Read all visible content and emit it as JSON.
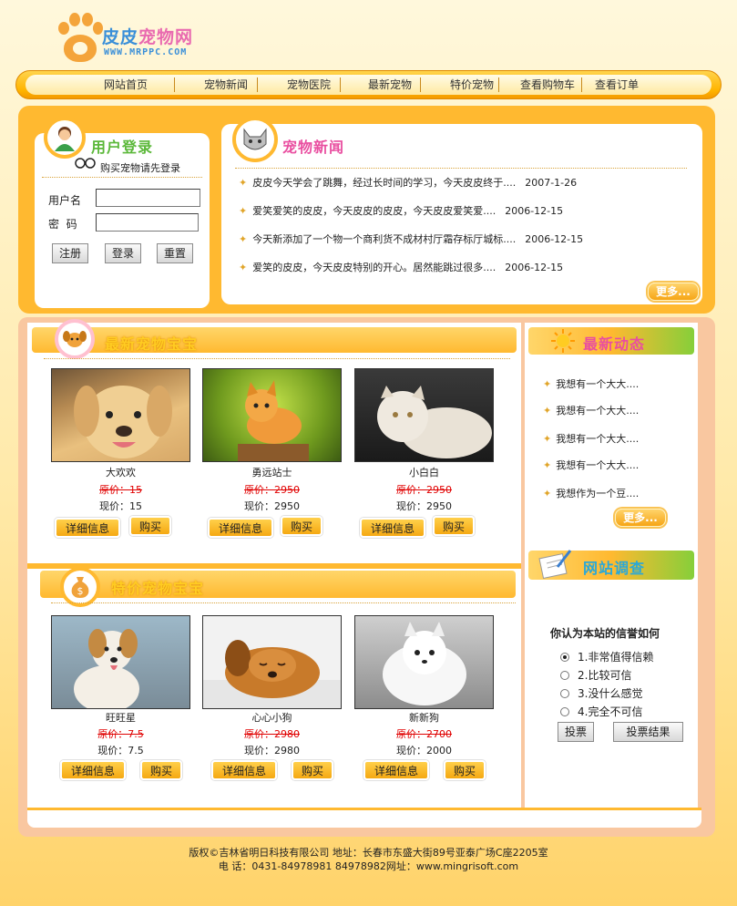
{
  "logo": {
    "brand_a": "皮皮",
    "brand_b": "宠物网",
    "url": "WWW.MRPPC.COM"
  },
  "nav": {
    "items": [
      {
        "label": "网站首页"
      },
      {
        "label": "宠物新闻"
      },
      {
        "label": "宠物医院"
      },
      {
        "label": "最新宠物"
      },
      {
        "label": "特价宠物"
      },
      {
        "label": "查看购物车"
      },
      {
        "label": "查看订单"
      }
    ]
  },
  "login": {
    "title": "用户登录",
    "hint": "购买宠物请先登录",
    "username_label": "用户名",
    "password_label": "密  码",
    "username_value": "",
    "password_value": "",
    "register_label": "注册",
    "login_label": "登录",
    "reset_label": "重置"
  },
  "news": {
    "title": "宠物新闻",
    "items": [
      {
        "text": "皮皮今天学会了跳舞，经过长时间的学习，今天皮皮终于....",
        "date": "2007-1-26"
      },
      {
        "text": "爱笑爱笑的皮皮，今天皮皮的皮皮，今天皮皮爱笑爱....",
        "date": "2006-12-15"
      },
      {
        "text": "今天新添加了一个物一个商利货不成材村厅霜存标厅城标....",
        "date": "2006-12-15"
      },
      {
        "text": "爱笑的皮皮，今天皮皮特别的开心。居然能跳过很多....",
        "date": "2006-12-15"
      }
    ],
    "more_label": "更多..."
  },
  "newest": {
    "title": "最新宠物宝宝",
    "pets": [
      {
        "name": "大欢欢",
        "old_price": "原价：15",
        "new_price": "现价：15"
      },
      {
        "name": "勇远站士",
        "old_price": "原价：2950",
        "new_price": "现价：2950"
      },
      {
        "name": "小白白",
        "old_price": "原价：2950",
        "new_price": "现价：2950"
      }
    ],
    "detail_label": "详细信息",
    "buy_label": "购买"
  },
  "special": {
    "title": "特价宠物宝宝",
    "pets": [
      {
        "name": "旺旺星",
        "old_price": "原价：7.5",
        "new_price": "现价：7.5"
      },
      {
        "name": "心心小狗",
        "old_price": "原价：2980",
        "new_price": "现价：2980"
      },
      {
        "name": "新新狗",
        "old_price": "原价：2700",
        "new_price": "现价：2000"
      }
    ],
    "detail_label": "详细信息",
    "buy_label": "购买"
  },
  "dynamics": {
    "title": "最新动态",
    "items": [
      {
        "text": "我想有一个大大...."
      },
      {
        "text": "我想有一个大大...."
      },
      {
        "text": "我想有一个大大...."
      },
      {
        "text": "我想有一个大大...."
      },
      {
        "text": "我想作为一个豆...."
      }
    ],
    "more_label": "更多..."
  },
  "survey": {
    "title": "网站调查",
    "question": "你认为本站的信誉如何",
    "options": [
      {
        "label": "1.非常值得信赖",
        "selected": true
      },
      {
        "label": "2.比较可信",
        "selected": false
      },
      {
        "label": "3.没什么感觉",
        "selected": false
      },
      {
        "label": "4.完全不可信",
        "selected": false
      }
    ],
    "vote_label": "投票",
    "result_label": "投票结果"
  },
  "footer": {
    "line1": "版权©吉林省明日科技有限公司  地址：长春市东盛大街89号亚泰广场C座2205室",
    "line2": "电 话：0431-84978981 84978982网址：www.mingrisoft.com"
  },
  "colors": {
    "accent": "#ffb930",
    "nav": "#ffb400",
    "price_old": "#e00000"
  }
}
